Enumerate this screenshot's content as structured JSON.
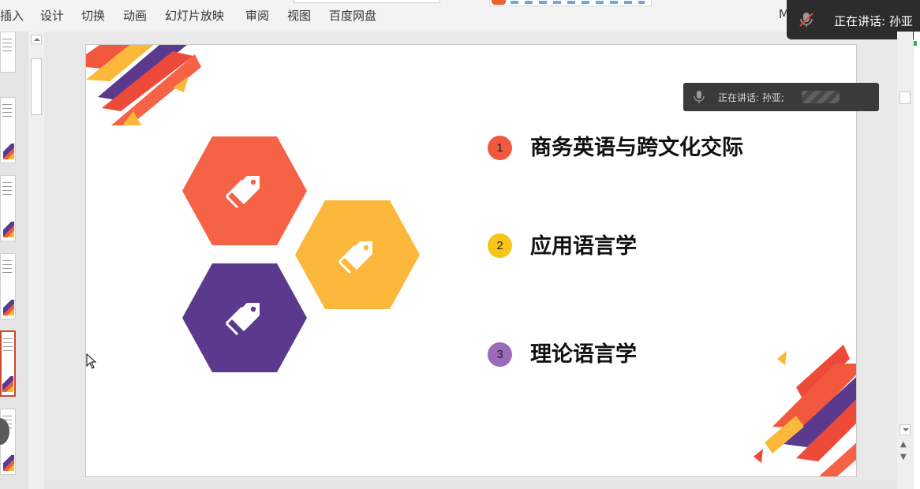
{
  "ribbon": {
    "tabs": [
      "插入",
      "设计",
      "切换",
      "动画",
      "幻灯片放映",
      "审阅",
      "视图",
      "百度网盘"
    ],
    "more_label": "M"
  },
  "speaker_top": {
    "text": "正在讲话: 孙亚"
  },
  "speaker_float": {
    "text": "正在讲话: 孙亚;"
  },
  "slide": {
    "items": [
      {
        "number": "1",
        "label": "商务英语与跨文化交际",
        "color": "#f2583e"
      },
      {
        "number": "2",
        "label": "应用语言学",
        "color": "#f5c518"
      },
      {
        "number": "3",
        "label": "理论语言学",
        "color": "#9a6bb8"
      }
    ],
    "hex_colors": {
      "top": "#f66246",
      "right": "#fbb83a",
      "bottom": "#5b3a8e"
    },
    "deco_colors": [
      "#5b3a8e",
      "#f2583e",
      "#fbb83a",
      "#ee4a3a"
    ]
  },
  "icons": {
    "speaker_mic": "microphone-muted-icon",
    "float_mic": "microphone-icon",
    "hex_tag": "price-tag-icon",
    "cursor": "mouse-pointer-icon"
  }
}
